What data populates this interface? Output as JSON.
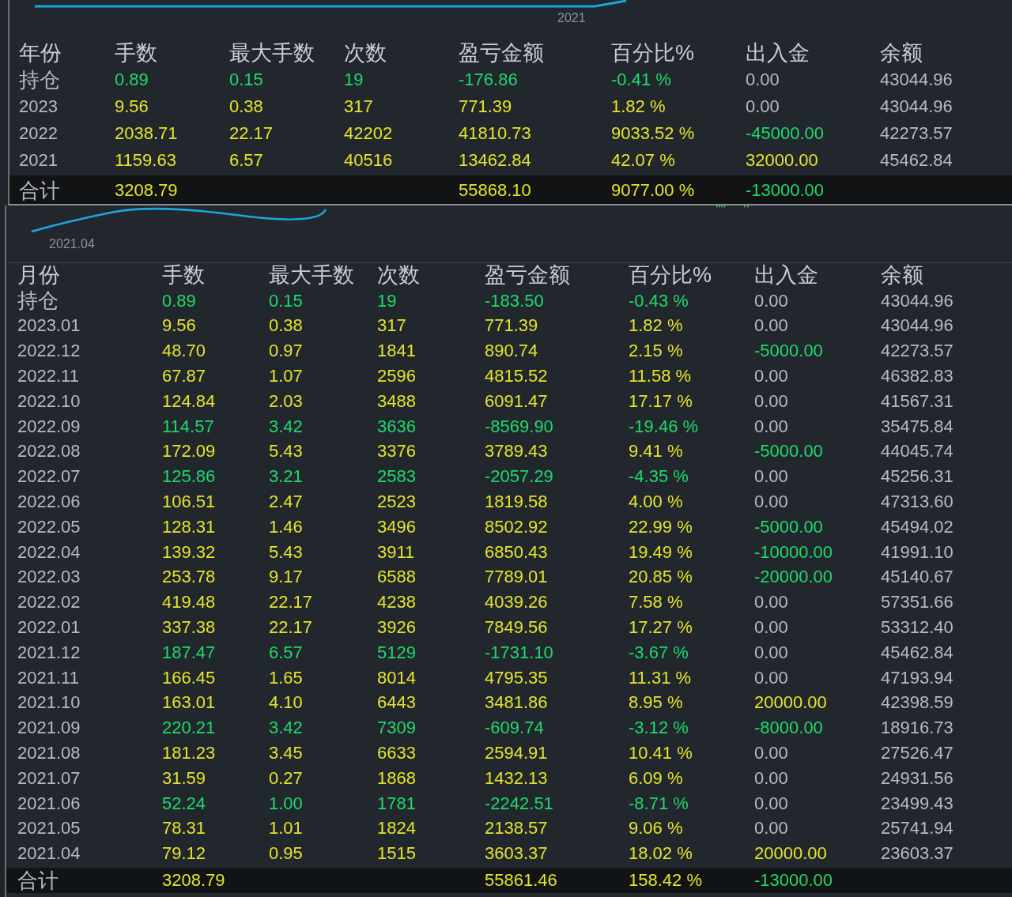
{
  "tables": [
    {
      "chart_label": "2021",
      "columns": [
        "年份",
        "手数",
        "最大手数",
        "次数",
        "盈亏金额",
        "百分比%",
        "出入金",
        "余额"
      ],
      "rows": [
        {
          "period": "持仓",
          "lots": "0.89",
          "max_lots": "0.15",
          "trades": "19",
          "profit": "-176.86",
          "percent": "-0.41 %",
          "flow_amount": "0.00",
          "balance": "43044.96",
          "loss": true,
          "deposit": false,
          "withdrawal": false
        },
        {
          "period": "2023",
          "lots": "9.56",
          "max_lots": "0.38",
          "trades": "317",
          "profit": "771.39",
          "percent": "1.82 %",
          "flow_amount": "0.00",
          "balance": "43044.96",
          "loss": false,
          "deposit": false,
          "withdrawal": false
        },
        {
          "period": "2022",
          "lots": "2038.71",
          "max_lots": "22.17",
          "trades": "42202",
          "profit": "41810.73",
          "percent": "9033.52 %",
          "flow_amount": "-45000.00",
          "balance": "42273.57",
          "loss": false,
          "deposit": false,
          "withdrawal": true
        },
        {
          "period": "2021",
          "lots": "1159.63",
          "max_lots": "6.57",
          "trades": "40516",
          "profit": "13462.84",
          "percent": "42.07 %",
          "flow_amount": "32000.00",
          "balance": "45462.84",
          "loss": false,
          "deposit": true,
          "withdrawal": false
        }
      ],
      "total": {
        "label": "合计",
        "lots": "3208.79",
        "profit": "55868.10",
        "percent": "9077.00 %",
        "flow_amount": "-13000.00",
        "deposit": false,
        "withdrawal": true
      }
    },
    {
      "chart_label": "2021.04",
      "columns": [
        "月份",
        "手数",
        "最大手数",
        "次数",
        "盈亏金额",
        "百分比%",
        "出入金",
        "余额"
      ],
      "rows": [
        {
          "period": "持仓",
          "lots": "0.89",
          "max_lots": "0.15",
          "trades": "19",
          "profit": "-183.50",
          "percent": "-0.43 %",
          "flow_amount": "0.00",
          "balance": "43044.96",
          "loss": true,
          "deposit": false,
          "withdrawal": false
        },
        {
          "period": "2023.01",
          "lots": "9.56",
          "max_lots": "0.38",
          "trades": "317",
          "profit": "771.39",
          "percent": "1.82 %",
          "flow_amount": "0.00",
          "balance": "43044.96",
          "loss": false,
          "deposit": false,
          "withdrawal": false
        },
        {
          "period": "2022.12",
          "lots": "48.70",
          "max_lots": "0.97",
          "trades": "1841",
          "profit": "890.74",
          "percent": "2.15 %",
          "flow_amount": "-5000.00",
          "balance": "42273.57",
          "loss": false,
          "deposit": false,
          "withdrawal": true
        },
        {
          "period": "2022.11",
          "lots": "67.87",
          "max_lots": "1.07",
          "trades": "2596",
          "profit": "4815.52",
          "percent": "11.58 %",
          "flow_amount": "0.00",
          "balance": "46382.83",
          "loss": false,
          "deposit": false,
          "withdrawal": false
        },
        {
          "period": "2022.10",
          "lots": "124.84",
          "max_lots": "2.03",
          "trades": "3488",
          "profit": "6091.47",
          "percent": "17.17 %",
          "flow_amount": "0.00",
          "balance": "41567.31",
          "loss": false,
          "deposit": false,
          "withdrawal": false
        },
        {
          "period": "2022.09",
          "lots": "114.57",
          "max_lots": "3.42",
          "trades": "3636",
          "profit": "-8569.90",
          "percent": "-19.46 %",
          "flow_amount": "0.00",
          "balance": "35475.84",
          "loss": true,
          "deposit": false,
          "withdrawal": false
        },
        {
          "period": "2022.08",
          "lots": "172.09",
          "max_lots": "5.43",
          "trades": "3376",
          "profit": "3789.43",
          "percent": "9.41 %",
          "flow_amount": "-5000.00",
          "balance": "44045.74",
          "loss": false,
          "deposit": false,
          "withdrawal": true
        },
        {
          "period": "2022.07",
          "lots": "125.86",
          "max_lots": "3.21",
          "trades": "2583",
          "profit": "-2057.29",
          "percent": "-4.35 %",
          "flow_amount": "0.00",
          "balance": "45256.31",
          "loss": true,
          "deposit": false,
          "withdrawal": false
        },
        {
          "period": "2022.06",
          "lots": "106.51",
          "max_lots": "2.47",
          "trades": "2523",
          "profit": "1819.58",
          "percent": "4.00 %",
          "flow_amount": "0.00",
          "balance": "47313.60",
          "loss": false,
          "deposit": false,
          "withdrawal": false
        },
        {
          "period": "2022.05",
          "lots": "128.31",
          "max_lots": "1.46",
          "trades": "3496",
          "profit": "8502.92",
          "percent": "22.99 %",
          "flow_amount": "-5000.00",
          "balance": "45494.02",
          "loss": false,
          "deposit": false,
          "withdrawal": true
        },
        {
          "period": "2022.04",
          "lots": "139.32",
          "max_lots": "5.43",
          "trades": "3911",
          "profit": "6850.43",
          "percent": "19.49 %",
          "flow_amount": "-10000.00",
          "balance": "41991.10",
          "loss": false,
          "deposit": false,
          "withdrawal": true
        },
        {
          "period": "2022.03",
          "lots": "253.78",
          "max_lots": "9.17",
          "trades": "6588",
          "profit": "7789.01",
          "percent": "20.85 %",
          "flow_amount": "-20000.00",
          "balance": "45140.67",
          "loss": false,
          "deposit": false,
          "withdrawal": true
        },
        {
          "period": "2022.02",
          "lots": "419.48",
          "max_lots": "22.17",
          "trades": "4238",
          "profit": "4039.26",
          "percent": "7.58 %",
          "flow_amount": "0.00",
          "balance": "57351.66",
          "loss": false,
          "deposit": false,
          "withdrawal": false
        },
        {
          "period": "2022.01",
          "lots": "337.38",
          "max_lots": "22.17",
          "trades": "3926",
          "profit": "7849.56",
          "percent": "17.27 %",
          "flow_amount": "0.00",
          "balance": "53312.40",
          "loss": false,
          "deposit": false,
          "withdrawal": false
        },
        {
          "period": "2021.12",
          "lots": "187.47",
          "max_lots": "6.57",
          "trades": "5129",
          "profit": "-1731.10",
          "percent": "-3.67 %",
          "flow_amount": "0.00",
          "balance": "45462.84",
          "loss": true,
          "deposit": false,
          "withdrawal": false
        },
        {
          "period": "2021.11",
          "lots": "166.45",
          "max_lots": "1.65",
          "trades": "8014",
          "profit": "4795.35",
          "percent": "11.31 %",
          "flow_amount": "0.00",
          "balance": "47193.94",
          "loss": false,
          "deposit": false,
          "withdrawal": false
        },
        {
          "period": "2021.10",
          "lots": "163.01",
          "max_lots": "4.10",
          "trades": "6443",
          "profit": "3481.86",
          "percent": "8.95 %",
          "flow_amount": "20000.00",
          "balance": "42398.59",
          "loss": false,
          "deposit": true,
          "withdrawal": false
        },
        {
          "period": "2021.09",
          "lots": "220.21",
          "max_lots": "3.42",
          "trades": "7309",
          "profit": "-609.74",
          "percent": "-3.12 %",
          "flow_amount": "-8000.00",
          "balance": "18916.73",
          "loss": true,
          "deposit": false,
          "withdrawal": true
        },
        {
          "period": "2021.08",
          "lots": "181.23",
          "max_lots": "3.45",
          "trades": "6633",
          "profit": "2594.91",
          "percent": "10.41 %",
          "flow_amount": "0.00",
          "balance": "27526.47",
          "loss": false,
          "deposit": false,
          "withdrawal": false
        },
        {
          "period": "2021.07",
          "lots": "31.59",
          "max_lots": "0.27",
          "trades": "1868",
          "profit": "1432.13",
          "percent": "6.09 %",
          "flow_amount": "0.00",
          "balance": "24931.56",
          "loss": false,
          "deposit": false,
          "withdrawal": false
        },
        {
          "period": "2021.06",
          "lots": "52.24",
          "max_lots": "1.00",
          "trades": "1781",
          "profit": "-2242.51",
          "percent": "-8.71 %",
          "flow_amount": "0.00",
          "balance": "23499.43",
          "loss": true,
          "deposit": false,
          "withdrawal": false
        },
        {
          "period": "2021.05",
          "lots": "78.31",
          "max_lots": "1.01",
          "trades": "1824",
          "profit": "2138.57",
          "percent": "9.06 %",
          "flow_amount": "0.00",
          "balance": "25741.94",
          "loss": false,
          "deposit": false,
          "withdrawal": false
        },
        {
          "period": "2021.04",
          "lots": "79.12",
          "max_lots": "0.95",
          "trades": "1515",
          "profit": "3603.37",
          "percent": "18.02 %",
          "flow_amount": "20000.00",
          "balance": "23603.37",
          "loss": false,
          "deposit": true,
          "withdrawal": false
        }
      ],
      "total": {
        "label": "合计",
        "lots": "3208.79",
        "profit": "55861.46",
        "percent": "158.42 %",
        "flow_amount": "-13000.00",
        "deposit": false,
        "withdrawal": true
      }
    }
  ]
}
